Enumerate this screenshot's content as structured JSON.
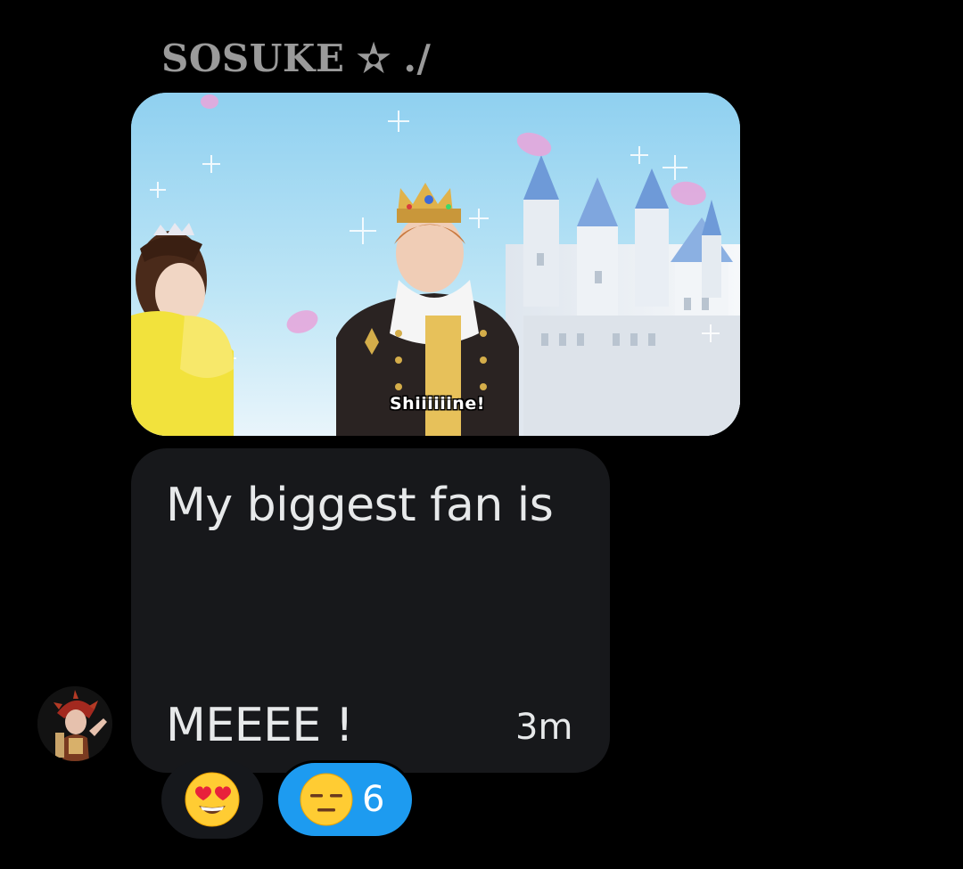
{
  "sender": {
    "name": "SOSUKE ✫ ./"
  },
  "image_message": {
    "subtitle": "Shiiiiiine!"
  },
  "text_message": {
    "line1": "My biggest fan is",
    "line2": "MEEEE !",
    "timestamp": "3m"
  },
  "reactions": [
    {
      "emoji": "heart-eyes-emoji",
      "count": ""
    },
    {
      "emoji": "expressionless-face-emoji",
      "count": "6",
      "selected": true
    }
  ],
  "colors": {
    "background": "#000000",
    "bubble": "#17181b",
    "text": "#e7e9ea",
    "sender_name": "#9a9a9a",
    "selected_reaction": "#1d9bf0",
    "reaction_pill": "#16181c"
  }
}
